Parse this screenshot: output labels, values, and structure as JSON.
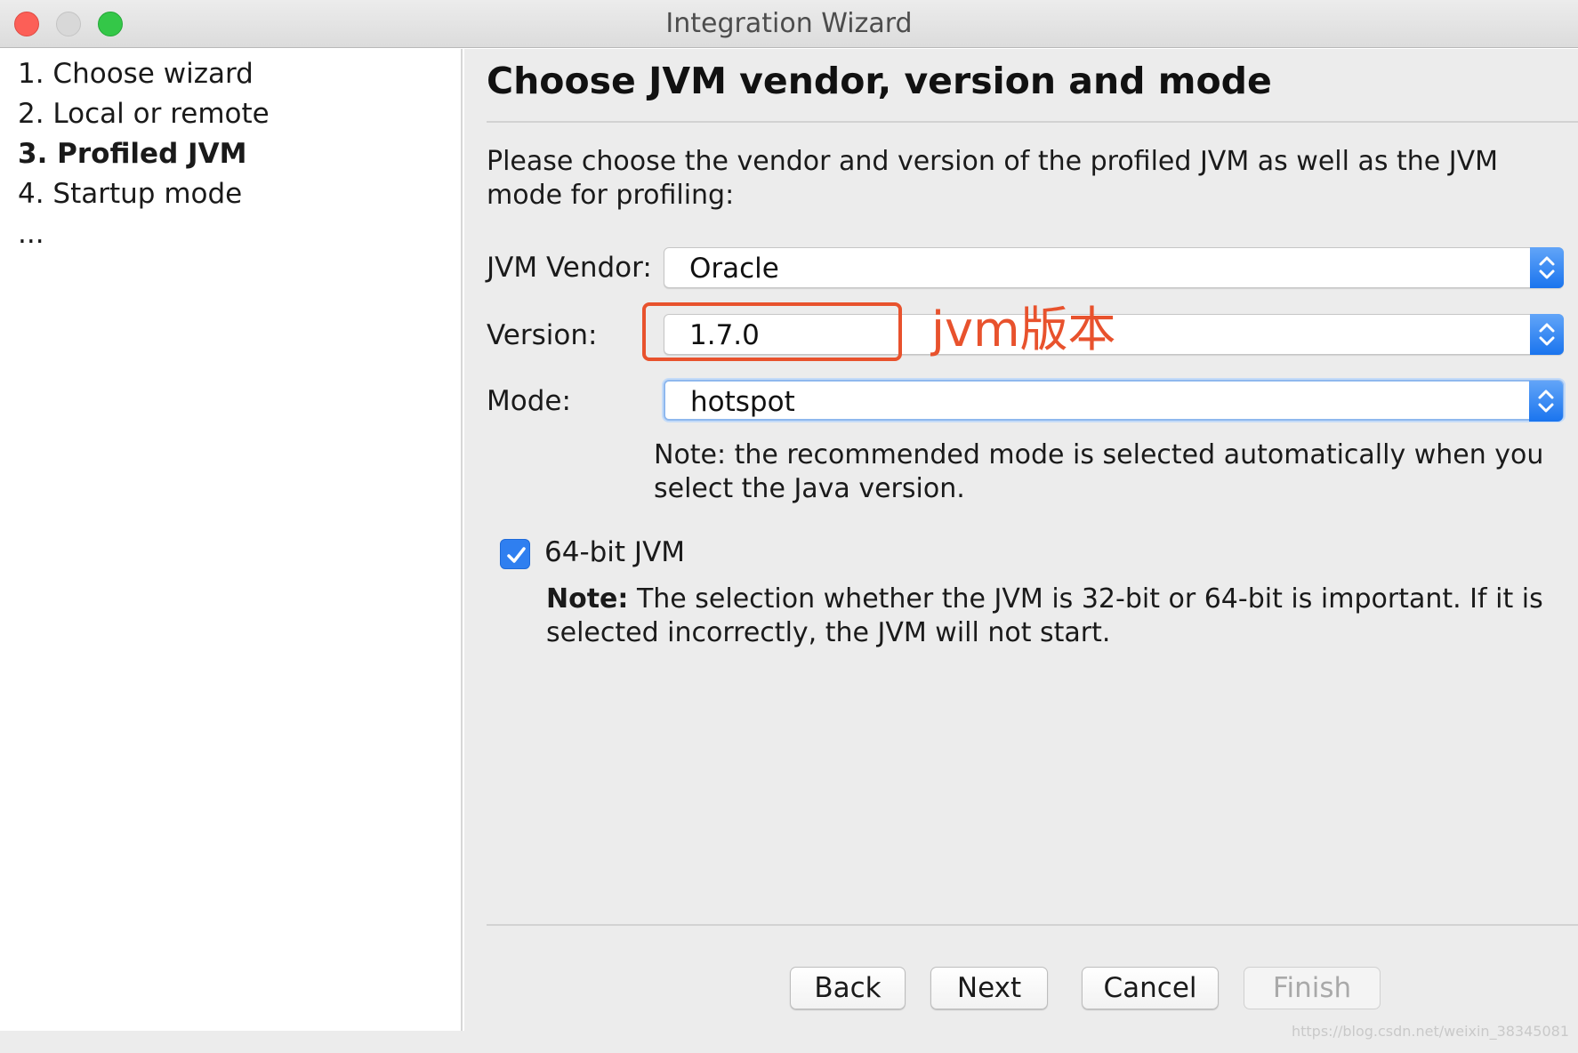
{
  "window": {
    "title": "Integration Wizard"
  },
  "steps": [
    {
      "label": "1. Choose wizard",
      "active": false
    },
    {
      "label": "2. Local or remote",
      "active": false
    },
    {
      "label": "3. Profiled JVM",
      "active": true
    },
    {
      "label": "4. Startup mode",
      "active": false
    },
    {
      "label": "...",
      "active": false
    }
  ],
  "main": {
    "title": "Choose JVM vendor, version and mode",
    "description": "Please choose the vendor and version of the profiled JVM as well as the JVM mode for profiling:",
    "fields": {
      "vendor": {
        "label": "JVM Vendor:",
        "value": "Oracle"
      },
      "version": {
        "label": "Version:",
        "value": "1.7.0"
      },
      "mode": {
        "label": "Mode:",
        "value": "hotspot"
      }
    },
    "mode_note": "Note: the recommended mode is selected automatically when you select the Java version.",
    "checkbox": {
      "label": "64-bit JVM",
      "checked": true
    },
    "bit_note": {
      "prefix": "Note:",
      "text": " The selection whether the JVM is 32-bit or 64-bit is important. If it is selected incorrectly, the JVM will not start."
    }
  },
  "annotation": {
    "text": "jvm版本",
    "color": "#e8522d"
  },
  "buttons": {
    "back": "Back",
    "next": "Next",
    "cancel": "Cancel",
    "finish": "Finish"
  },
  "watermark": "https://blog.csdn.net/weixin_38345081",
  "colors": {
    "accent": "#2f7ff0",
    "annotation": "#e8522d"
  }
}
